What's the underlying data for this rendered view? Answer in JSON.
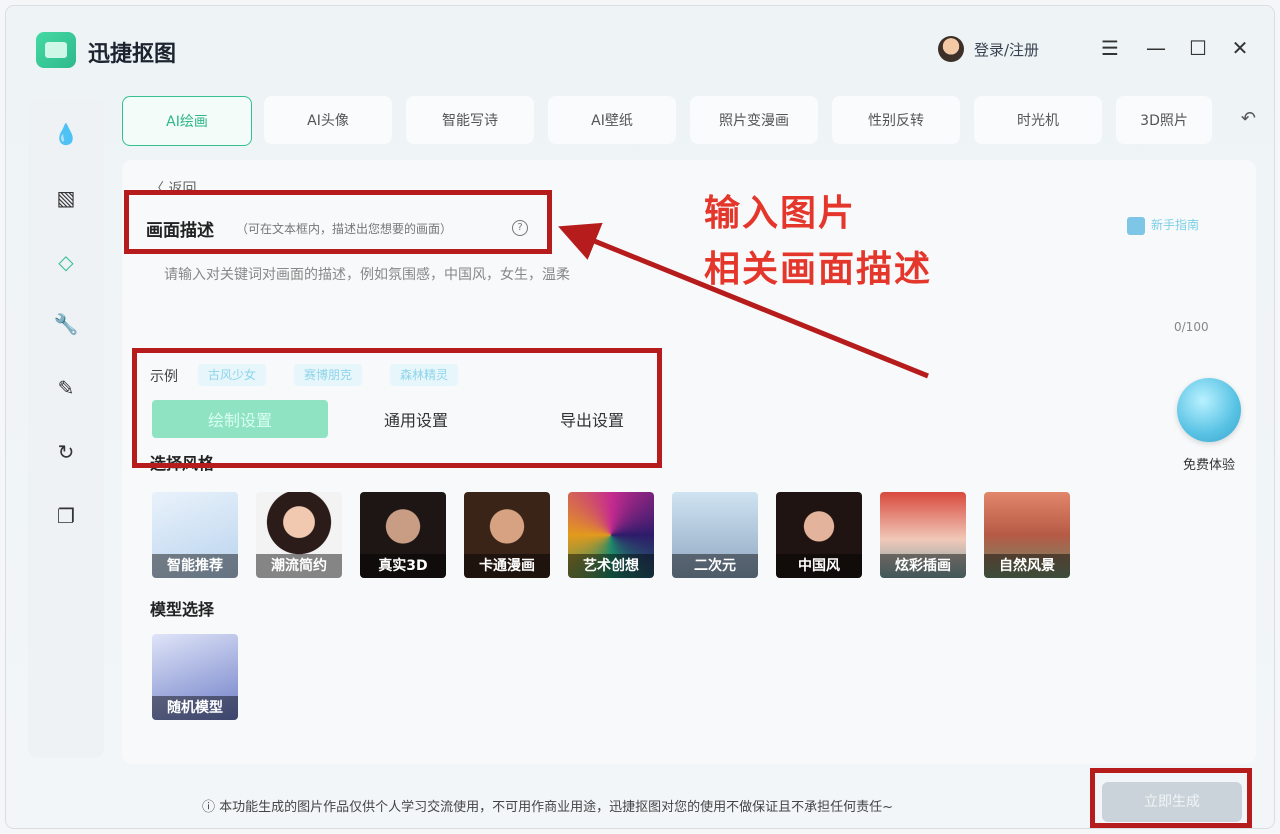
{
  "app": {
    "title": "迅捷抠图",
    "login_label": "登录/注册"
  },
  "window_controls": [
    "☰",
    "—",
    "☐",
    "✕"
  ],
  "tabs": [
    {
      "label": "AI绘画",
      "active": true
    },
    {
      "label": "AI头像"
    },
    {
      "label": "智能写诗"
    },
    {
      "label": "AI壁纸"
    },
    {
      "label": "照片变漫画"
    },
    {
      "label": "性别反转"
    },
    {
      "label": "时光机"
    },
    {
      "label": "3D照片"
    }
  ],
  "panel": {
    "back_label": "〈 返回",
    "section_title": "画面描述",
    "section_hint": "（可在文本框内，描述出您想要的画面）",
    "guide_label": "新手指南",
    "placeholder": "请输入对关键词对画面的描述，例如氛围感，中国风，女生，温柔",
    "counter": "0/100",
    "examples_label": "示例",
    "example_chips": [
      "古风少女",
      "赛博朋克",
      "森林精灵"
    ],
    "subtabs": [
      {
        "label": "绘制设置",
        "active": true
      },
      {
        "label": "通用设置"
      },
      {
        "label": "导出设置"
      }
    ],
    "style_label": "选择风格",
    "styles": [
      "智能推荐",
      "潮流简约",
      "真实3D",
      "卡通漫画",
      "艺术创想",
      "二次元",
      "中国风",
      "炫彩插画",
      "自然风景"
    ],
    "model_label": "模型选择",
    "model": "随机模型",
    "free_trial": "免费体验"
  },
  "footer": {
    "notice": "ⓘ 本功能生成的图片作品仅供个人学习交流使用，不可用作商业用途，迅捷抠图对您的使用不做保证且不承担任何责任~",
    "generate_label": "立即生成"
  },
  "annotation": {
    "line1": "输入图片",
    "line2": "相关画面描述",
    "color": "#e4362b"
  },
  "colors": {
    "accent": "#36c08f",
    "annotation_box": "#b71c1c"
  }
}
